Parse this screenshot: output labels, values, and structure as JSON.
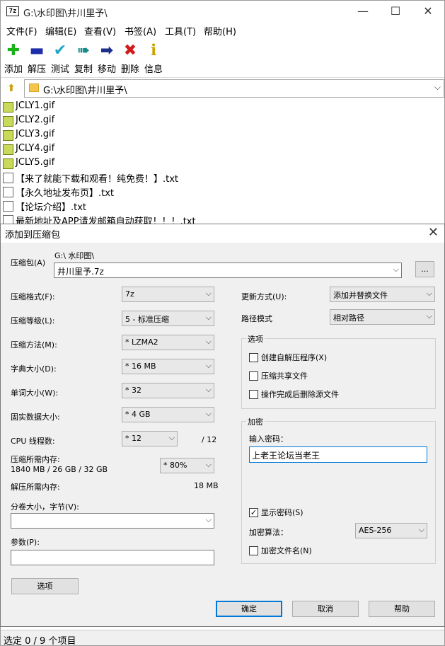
{
  "window": {
    "app_icon": "7z",
    "title": "G:\\水印图\\井川里予\\",
    "minimize": "—",
    "maximize": "☐",
    "close": "✕"
  },
  "menu": [
    "文件(F)",
    "编辑(E)",
    "查看(V)",
    "书签(A)",
    "工具(T)",
    "帮助(H)"
  ],
  "toolbar": [
    {
      "label": "添加",
      "icon": "plus-icon",
      "glyph": "✚",
      "color": "#19b319"
    },
    {
      "label": "解压",
      "icon": "minus-icon",
      "glyph": "▬",
      "color": "#1c2fa8"
    },
    {
      "label": "测试",
      "icon": "check-icon",
      "glyph": "✔",
      "color": "#21a6c9"
    },
    {
      "label": "复制",
      "icon": "double-arrow-icon",
      "glyph": "➠",
      "color": "#178a8a"
    },
    {
      "label": "移动",
      "icon": "arrow-right-icon",
      "glyph": "➡",
      "color": "#1c2f8a"
    },
    {
      "label": "删除",
      "icon": "delete-icon",
      "glyph": "✖",
      "color": "#d11a1a"
    },
    {
      "label": "信息",
      "icon": "info-icon",
      "glyph": "ℹ",
      "color": "#c9a400"
    }
  ],
  "address": {
    "path": "G:\\水印图\\井川里予\\",
    "up_glyph": "⬆",
    "dropdown_glyph": "⌵"
  },
  "files": [
    {
      "name": "JCLY1.gif",
      "type": "gif"
    },
    {
      "name": "JCLY2.gif",
      "type": "gif"
    },
    {
      "name": "JCLY3.gif",
      "type": "gif"
    },
    {
      "name": "JCLY4.gif",
      "type": "gif"
    },
    {
      "name": "JCLY5.gif",
      "type": "gif"
    },
    {
      "name": "【来了就能下载和观看！纯免费！】.txt",
      "type": "txt"
    },
    {
      "name": "【永久地址发布页】.txt",
      "type": "txt"
    },
    {
      "name": "【论坛介绍】.txt",
      "type": "txt"
    },
    {
      "name": "最新地址及APP请发邮箱自动获取！！！.txt",
      "type": "txt"
    }
  ],
  "status": "选定 0 / 9 个项目",
  "dialog": {
    "title": "添加到压缩包",
    "close": "✕",
    "archive_label": "压缩包(A)",
    "archive_dir": "G:\\ 水印图\\",
    "archive_name": "井川里予.7z",
    "browse_label": "...",
    "format_label": "压缩格式(F):",
    "format_value": "7z",
    "level_label": "压缩等级(L):",
    "level_value": "5 - 标准压缩",
    "method_label": "压缩方法(M):",
    "method_value": "*  LZMA2",
    "dict_label": "字典大小(D):",
    "dict_value": "*  16 MB",
    "word_label": "单词大小(W):",
    "word_value": "*  32",
    "solid_label": "固实数据大小:",
    "solid_value": "*  4 GB",
    "cpu_label": "CPU 线程数:",
    "cpu_value": "*  12",
    "cpu_total": "/ 12",
    "mem_label": "压缩所需内存:",
    "mem_value": "1840 MB / 26 GB / 32 GB",
    "mem_percent": "*  80%",
    "decomp_label": "解压所需内存:",
    "decomp_value": "18 MB",
    "split_label": "分卷大小，字节(V):",
    "split_value": "",
    "params_label": "参数(P):",
    "params_value": "",
    "options_button": "选项",
    "update_label": "更新方式(U):",
    "update_value": "添加并替换文件",
    "path_mode_label": "路径模式",
    "path_mode_value": "相对路径",
    "options_group": "选项",
    "opt_sfx": "创建自解压程序(X)",
    "opt_shared": "压缩共享文件",
    "opt_delete": "操作完成后删除源文件",
    "encrypt_group": "加密",
    "password_label": "输入密码：",
    "password_value": "上老王论坛当老王",
    "show_password": "显示密码(S)",
    "enc_method_label": "加密算法：",
    "enc_method_value": "AES-256",
    "enc_names": "加密文件名(N)",
    "ok": "确定",
    "cancel": "取消",
    "help": "帮助",
    "dropdown_glyph": "⌵",
    "check_glyph": "✓"
  }
}
